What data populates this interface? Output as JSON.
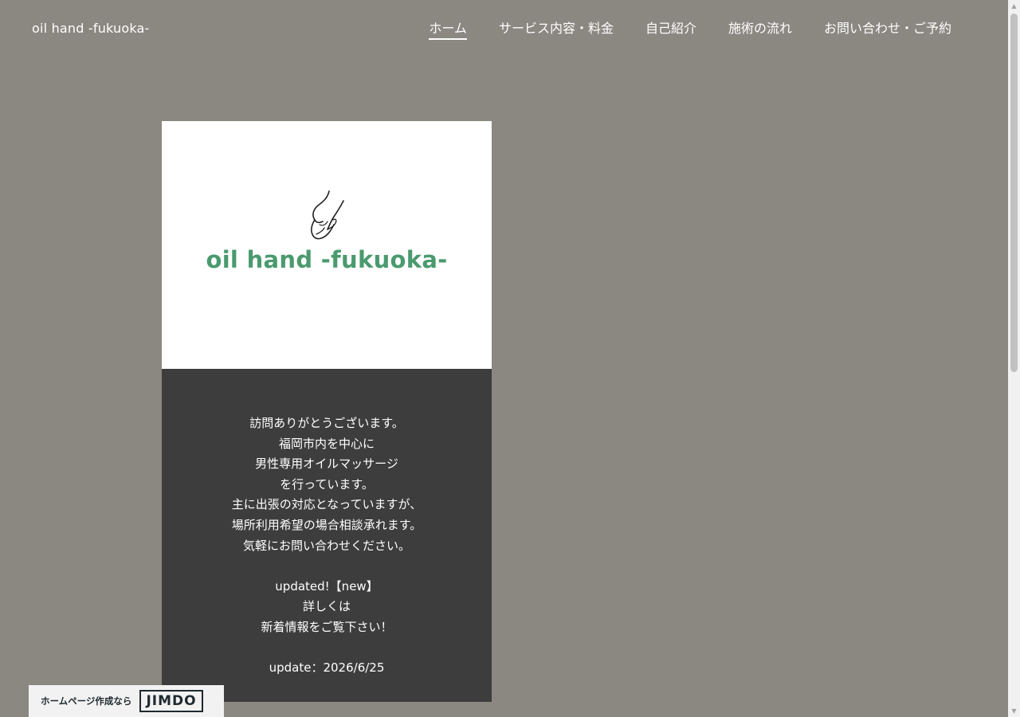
{
  "header": {
    "site_title": "oil hand -fukuoka-",
    "nav": [
      {
        "label": "ホーム",
        "active": true
      },
      {
        "label": "サービス内容・料金",
        "active": false
      },
      {
        "label": "自己紹介",
        "active": false
      },
      {
        "label": "施術の流れ",
        "active": false
      },
      {
        "label": "お問い合わせ・ご予約",
        "active": false
      }
    ]
  },
  "main": {
    "logo_text": "oil hand -fukuoka-",
    "lines": [
      "訪問ありがとうございます。",
      "福岡市内を中心に",
      "男性専用オイルマッサージ",
      "を行っています。",
      "主に出張の対応となっていますが、",
      "場所利用希望の場合相談承れます。",
      "気軽にお問い合わせください。",
      "",
      "updated!【new】",
      "詳しくは",
      "新着情報をご覧下さい！",
      "",
      "update：2026/6/25"
    ]
  },
  "footer_badge": {
    "text": "ホームページ作成なら",
    "logo": "JIMDO"
  },
  "colors": {
    "background": "#8b8781",
    "panel_dark": "#3d3d3d",
    "logo_green": "#4a9a6e"
  }
}
